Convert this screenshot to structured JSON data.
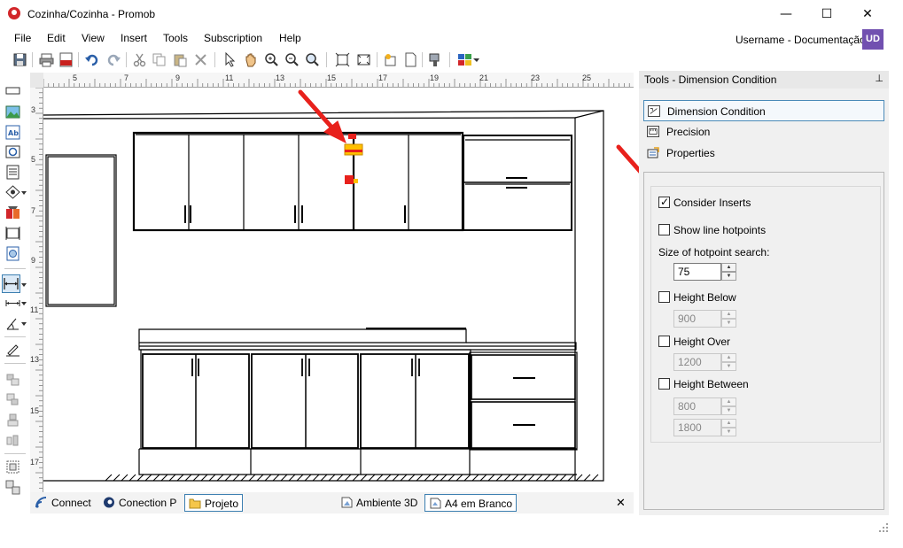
{
  "window": {
    "title": "Cozinha/Cozinha - Promob",
    "minimize": "—",
    "maximize": "☐",
    "close": "✕"
  },
  "menu": {
    "items": [
      "File",
      "Edit",
      "View",
      "Insert",
      "Tools",
      "Subscription",
      "Help"
    ]
  },
  "user": {
    "name": "Username - Documentação",
    "initials": "UD",
    "avatar_color": "#7150b0"
  },
  "ruler": {
    "top_labels": [
      "5",
      "7",
      "9",
      "11",
      "13",
      "15",
      "17",
      "19",
      "21",
      "23",
      "25"
    ],
    "left_labels": [
      "3",
      "5",
      "7",
      "9",
      "11",
      "13",
      "15",
      "17"
    ]
  },
  "bottom_tabs": {
    "items": [
      {
        "label": "Connect",
        "icon": "connect-icon"
      },
      {
        "label": "Conection P",
        "icon": "promob-icon"
      },
      {
        "label": "Projeto",
        "icon": "folder-icon"
      },
      {
        "label": "Ambiente 3D",
        "icon": "3d-scene-icon"
      },
      {
        "label": "A4 em Branco",
        "icon": "page-icon"
      }
    ],
    "close": "✕"
  },
  "panel": {
    "title": "Tools - Dimension Condition",
    "pin": "⊥",
    "sections": [
      {
        "label": "Dimension Condition",
        "icon": "dimension-condition-icon",
        "selected": true
      },
      {
        "label": "Precision",
        "icon": "precision-icon",
        "selected": false
      },
      {
        "label": "Properties",
        "icon": "properties-icon",
        "selected": false
      }
    ],
    "consider_inserts": {
      "label": "Consider Inserts",
      "checked": true
    },
    "show_line_hotpoints": {
      "label": "Show line hotpoints",
      "checked": false
    },
    "hotpoint_size": {
      "label": "Size of hotpoint search:",
      "value": "75"
    },
    "height_below": {
      "label": "Height Below",
      "checked": false,
      "value": "900"
    },
    "height_over": {
      "label": "Height Over",
      "checked": false,
      "value": "1200"
    },
    "height_between": {
      "label": "Height Between",
      "checked": false,
      "value_min": "800",
      "value_max": "1800"
    }
  },
  "colors": {
    "accent": "#3c7fb1",
    "arrow": "#e8211c",
    "marker": "#ffc000"
  }
}
